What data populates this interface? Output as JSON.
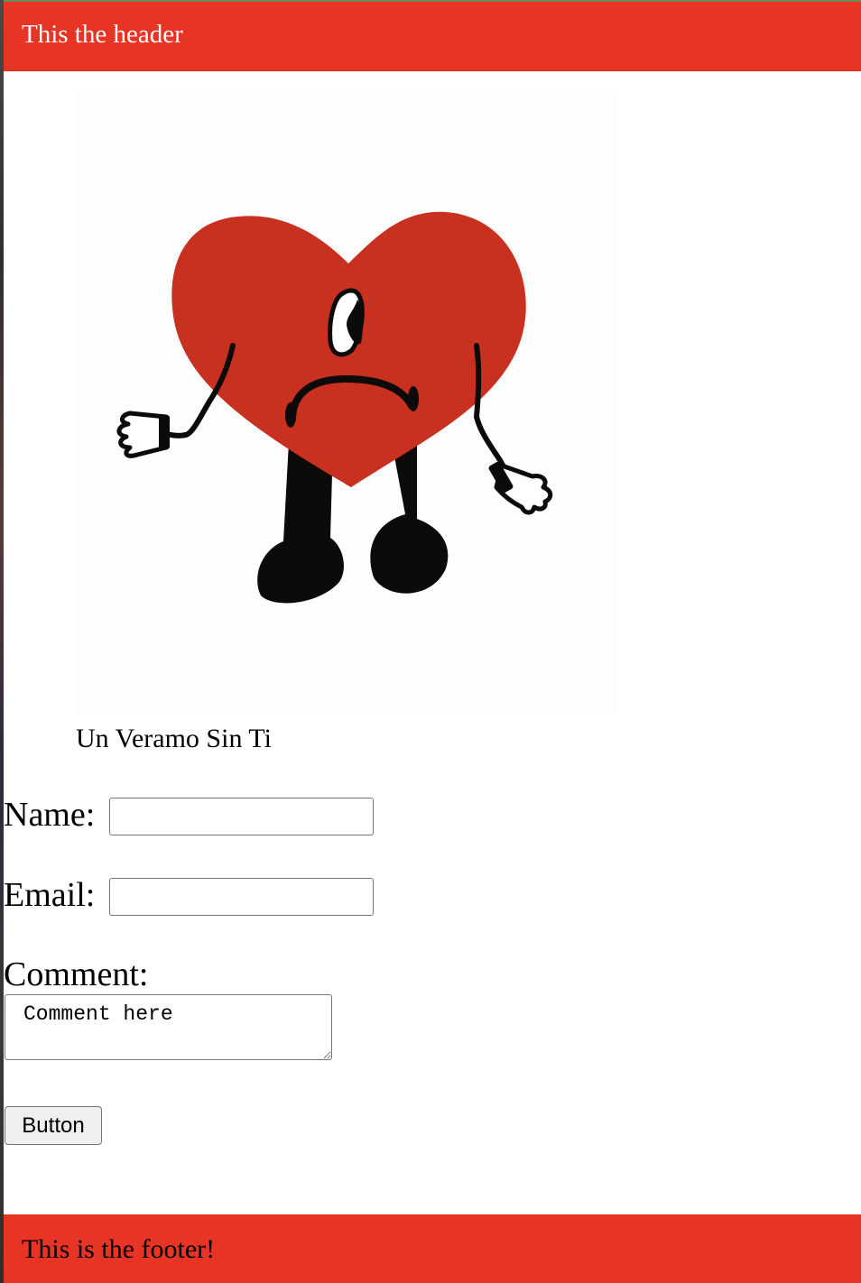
{
  "header": {
    "title": "This the header",
    "background_color": "#e83424"
  },
  "figure": {
    "image": "sad-heart-character-icon",
    "caption": "Un Veramo Sin Ti"
  },
  "form": {
    "name_label": "Name:",
    "name_value": "",
    "email_label": "Email:",
    "email_value": "",
    "comment_label": "Comment:",
    "comment_placeholder": "Comment here",
    "button_label": "Button"
  },
  "footer": {
    "text": "This is the footer!",
    "background_color": "#e83424"
  }
}
